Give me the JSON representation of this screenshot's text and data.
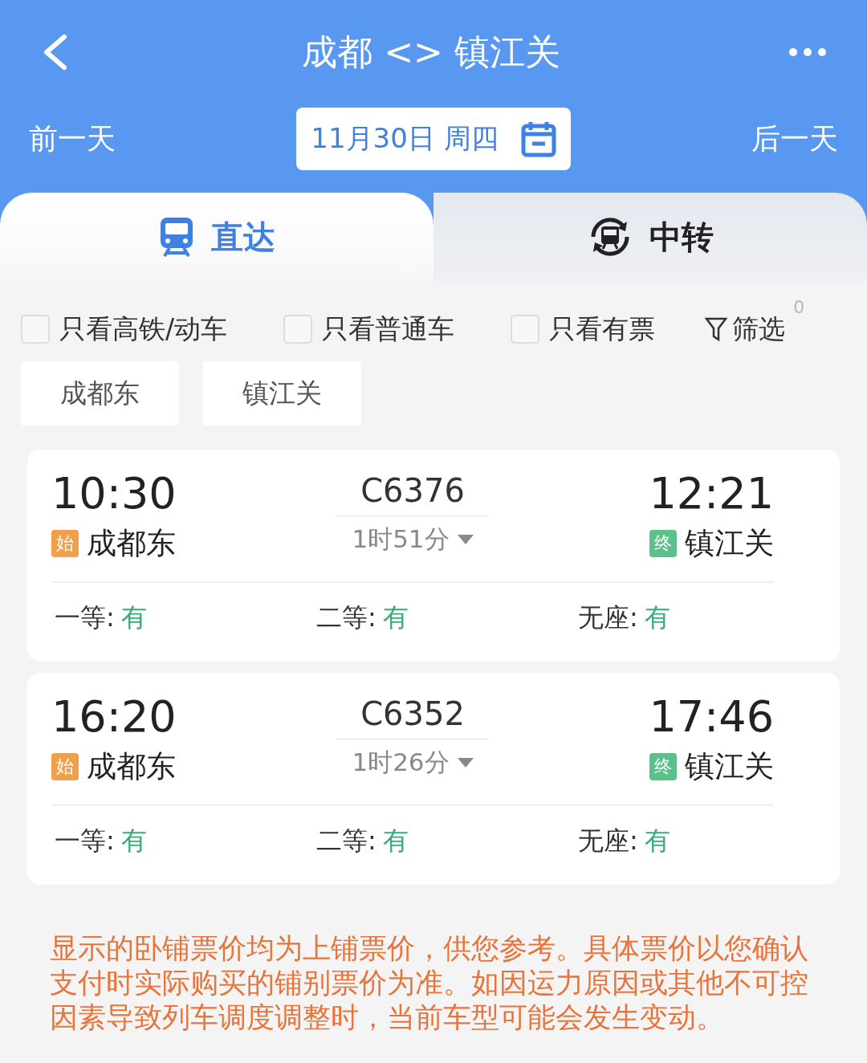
{
  "header": {
    "title": "成都 <> 镇江关",
    "prev_day": "前一天",
    "date": "11月30日 周四",
    "next_day": "后一天"
  },
  "tabs": [
    {
      "label": "直达",
      "selected": true,
      "kind": "direct"
    },
    {
      "label": "中转",
      "selected": false,
      "kind": "transfer"
    }
  ],
  "filters": [
    {
      "label": "只看高铁/动车",
      "checked": false
    },
    {
      "label": "只看普通车",
      "checked": false
    },
    {
      "label": "只看有票",
      "checked": false
    }
  ],
  "filter_button": {
    "label": "筛选",
    "count": "0"
  },
  "stations": [
    "成都东",
    "镇江关"
  ],
  "trains": [
    {
      "depart_time": "10:30",
      "depart_badge": "始",
      "depart_station": "成都东",
      "number": "C6376",
      "duration": "1时51分",
      "arrive_time": "12:21",
      "arrive_badge": "终",
      "arrive_station": "镇江关",
      "seats": [
        {
          "label": "一等:",
          "status": "有"
        },
        {
          "label": "二等:",
          "status": "有"
        },
        {
          "label": "无座:",
          "status": "有"
        }
      ]
    },
    {
      "depart_time": "16:20",
      "depart_badge": "始",
      "depart_station": "成都东",
      "number": "C6352",
      "duration": "1时26分",
      "arrive_time": "17:46",
      "arrive_badge": "终",
      "arrive_station": "镇江关",
      "seats": [
        {
          "label": "一等:",
          "status": "有"
        },
        {
          "label": "二等:",
          "status": "有"
        },
        {
          "label": "无座:",
          "status": "有"
        }
      ]
    }
  ],
  "notice": "显示的卧铺票价均为上铺票价，供您参考。具体票价以您确认支付时实际购买的铺别票价为准。如因运力原因或其他不可控因素导致列车调度调整时，当前车型可能会发生变动。"
}
